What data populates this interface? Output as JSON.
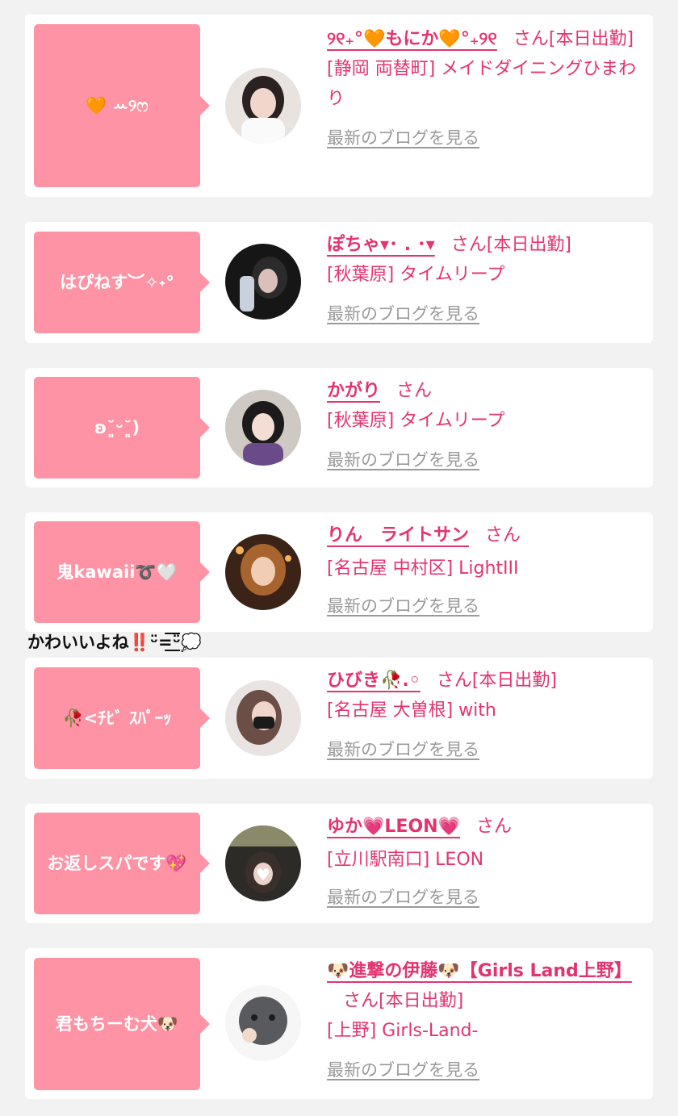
{
  "entries": [
    {
      "bubble": "🧡 ꕀ୨ෆ",
      "name": "୨୧₊°🧡もにか🧡°₊୨୧",
      "suffix": "さん",
      "tag": "[本日出勤]",
      "location": "[静岡 両替町] メイドダイニングひまわり",
      "blog": "最新のブログを見る",
      "avatar": "avatar-girl-white-sweater"
    },
    {
      "bubble": "はぴねす︶✧˖°",
      "name": "ぽちゃ▾･ . ･▾",
      "suffix": "さん",
      "tag": "[本日出勤]",
      "location": "[秋葉原] タイムリープ",
      "blog": "最新のブログを見る",
      "avatar": "avatar-girl-dark"
    },
    {
      "bubble": "ʚ˘͈ᵕ˘͈)",
      "name": "かがり",
      "suffix": "さん",
      "tag": "",
      "location": "[秋葉原] タイムリープ",
      "blog": "最新のブログを見る",
      "avatar": "avatar-girl-bows"
    },
    {
      "bubble": "鬼kawaii➰🤍",
      "name": "りん　ライトサン",
      "suffix": "さん",
      "tag": "",
      "location": "[名古屋 中村区] LightIII",
      "blog": "最新のブログを見る",
      "avatar": "avatar-anime-girl"
    },
    {
      "bubble": "🥀<ﾁﾋﾞ ｽﾊﾟｰｯ",
      "name": "ひびき🥀.◦",
      "suffix": "さん",
      "tag": "[本日出勤]",
      "location": "[名古屋 大曽根] with",
      "blog": "最新のブログを見る",
      "avatar": "avatar-girl-mask"
    },
    {
      "bubble": "お返しスパです💖",
      "name": "ゆか💗LEON💗",
      "suffix": "さん",
      "tag": "",
      "location": "[立川駅南口] LEON",
      "blog": "最新のブログを見る",
      "avatar": "avatar-girl-heart"
    },
    {
      "bubble": "君もちーむ犬🐶",
      "name": "🐶進撃の伊藤🐶【Girls Land上野】",
      "suffix": "さん",
      "tag": "[本日出勤]",
      "location": "[上野] Girls-Land-",
      "blog": "最新のブログを見る",
      "avatar": "avatar-gray-poodle"
    }
  ],
  "separator_text": "かわいいよね‼️ᵕ̈=͟͟͞ᵕ̈💭",
  "colors": {
    "page_bg": "#f2f2f2",
    "bubble_bg": "#fd93a5",
    "accent": "#e5336e",
    "link_gray": "#9a9a9a"
  }
}
